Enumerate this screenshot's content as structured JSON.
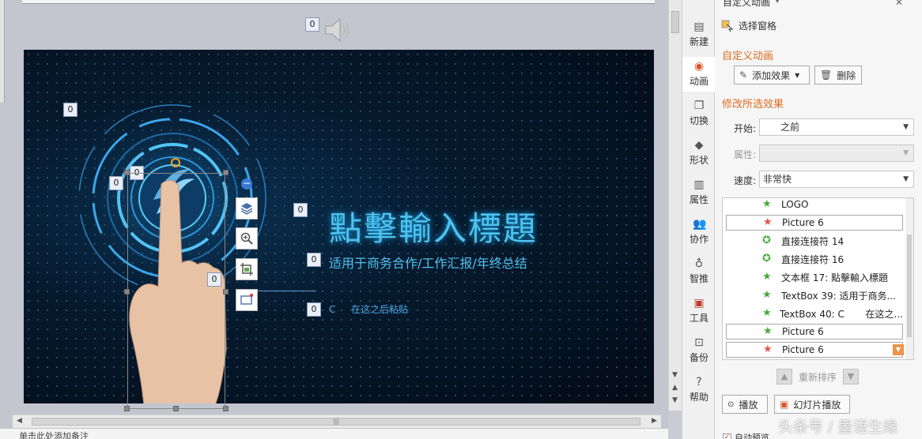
{
  "slide": {
    "title": "點擊輸入標題",
    "subtitle": "适用于商务合作/工作汇报/年终总结",
    "paste_prefix": "C",
    "paste_text": "在这之后粘贴"
  },
  "tags": [
    "0",
    "0",
    "0",
    "0",
    "0",
    "0",
    "0",
    "0"
  ],
  "notes": {
    "placeholder": "单击此处添加备注"
  },
  "sidebar": {
    "items": [
      {
        "label": "新建",
        "icon": "new-doc-icon"
      },
      {
        "label": "动画",
        "icon": "animation-icon"
      },
      {
        "label": "切换",
        "icon": "transition-icon"
      },
      {
        "label": "形状",
        "icon": "shape-icon"
      },
      {
        "label": "属性",
        "icon": "properties-icon"
      },
      {
        "label": "协作",
        "icon": "collaborate-icon"
      },
      {
        "label": "智推",
        "icon": "smart-recommend-icon"
      },
      {
        "label": "工具",
        "icon": "toolbox-icon"
      },
      {
        "label": "备份",
        "icon": "backup-icon"
      },
      {
        "label": "帮助",
        "icon": "help-icon"
      }
    ]
  },
  "pane": {
    "title": "自定义动画",
    "select_pane": "选择窗格",
    "custom_anim_title": "自定义动画",
    "add_effect": "添加效果",
    "delete": "删除",
    "modify_title": "修改所选效果",
    "start_label": "开始:",
    "start_value": "之前",
    "property_label": "属性:",
    "property_value": "",
    "speed_label": "速度:",
    "speed_value": "非常快",
    "reorder": "重新排序",
    "play": "播放",
    "slideshow": "幻灯片播放",
    "auto_preview": "自动预览"
  },
  "animations": [
    {
      "label": "LOGO",
      "type": "entrance"
    },
    {
      "label": "Picture 6",
      "type": "exit"
    },
    {
      "label": "直接连接符 14",
      "type": "emphasis"
    },
    {
      "label": "直接连接符 16",
      "type": "emphasis"
    },
    {
      "label": "文本框 17: 點擊輸入標題",
      "type": "entrance"
    },
    {
      "label": "TextBox 39: 适用于商务...",
      "type": "entrance"
    },
    {
      "label": "TextBox 40: C       在这之...",
      "type": "entrance"
    },
    {
      "label": "Picture 6",
      "type": "entrance"
    },
    {
      "label": "Picture 6",
      "type": "exit"
    }
  ],
  "colors": {
    "accent_orange": "#e06a1b",
    "slide_text": "#4fc2ef",
    "entrance_star": "#46a93a",
    "exit_star": "#e4534a"
  },
  "watermark": "头条号 / 墨语生缘"
}
